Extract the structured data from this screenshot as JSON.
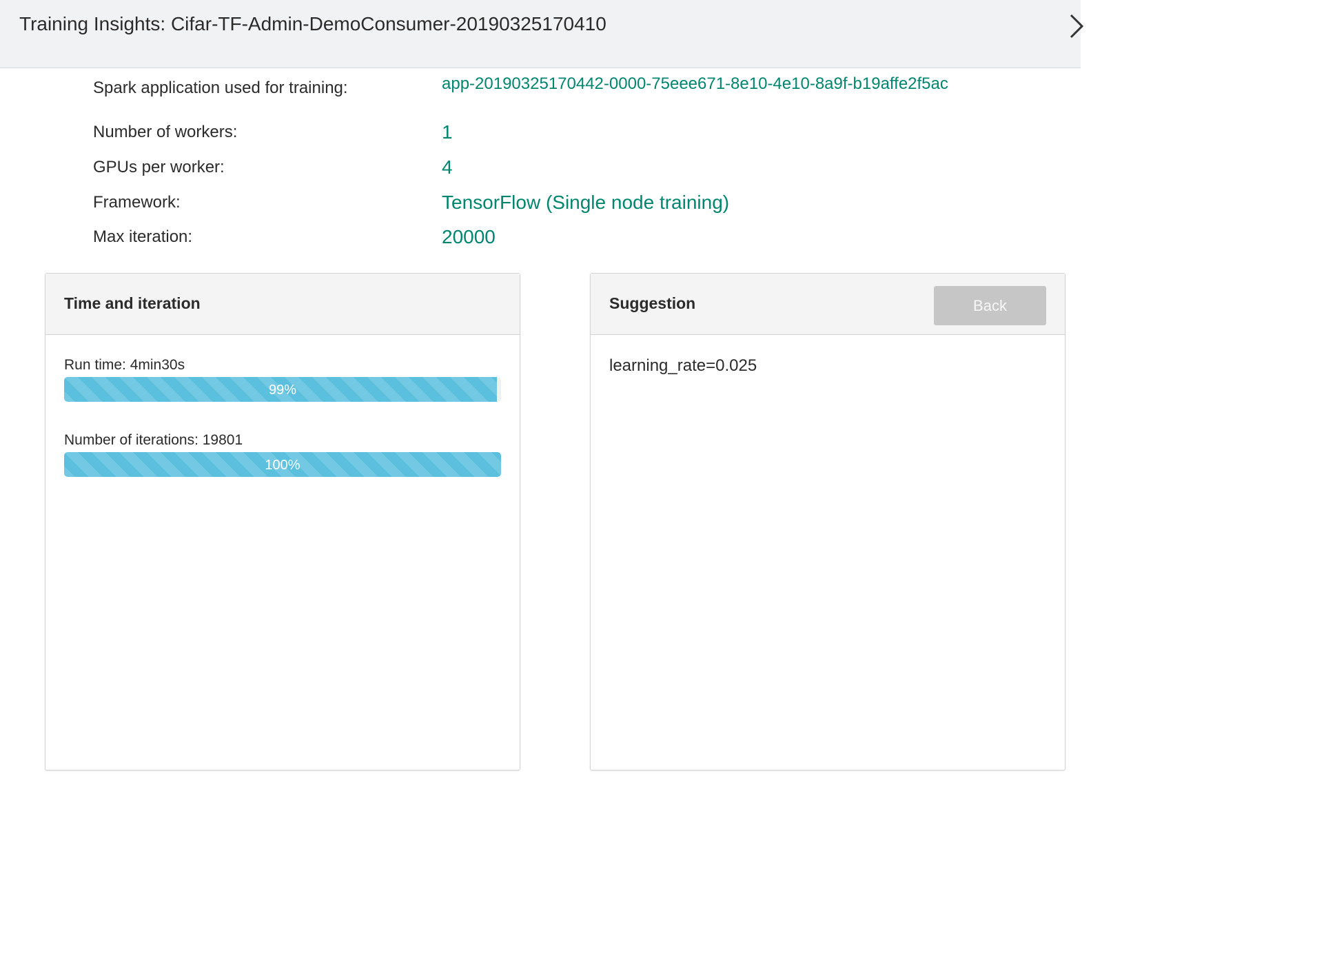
{
  "dialog": {
    "title": "Training Insights: Cifar-TF-Admin-DemoConsumer-20190325170410"
  },
  "info": {
    "spark_app_label": "Spark application used for training:",
    "spark_app_value": "app-20190325170442-0000-75eee671-8e10-4e10-8a9f-b19affe2f5ac",
    "workers_label": "Number of workers:",
    "workers_value": "1",
    "gpus_label": "GPUs per worker:",
    "gpus_value": "4",
    "framework_label": "Framework:",
    "framework_value": "TensorFlow (Single node training)",
    "max_iter_label": "Max iteration:",
    "max_iter_value": "20000"
  },
  "time_panel": {
    "title": "Time and iteration",
    "run_time_label": "Run time: 4min30s",
    "run_time_progress": 0.99,
    "run_time_percent": "99%",
    "iterations_label": "Number of iterations: 19801",
    "iterations_progress": 1.0,
    "iterations_percent": "100%"
  },
  "suggestion_panel": {
    "title": "Suggestion",
    "back_label": "Back",
    "suggestion": "learning_rate=0.025"
  },
  "colors": {
    "accent": "#00866f",
    "progress": "#5bc0de",
    "button_disabled": "#c6c6c6"
  }
}
